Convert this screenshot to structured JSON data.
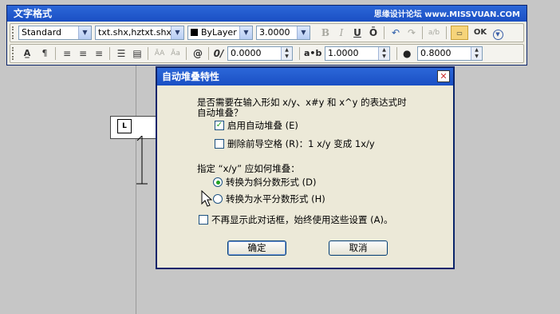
{
  "toolbar": {
    "title": "文字格式",
    "watermark": "思缘设计论坛 www.MISSVUAN.COM",
    "style_value": "Standard",
    "font_value": "txt.shx,hztxt.shx",
    "color_value": "ByLayer",
    "height_value": "3.0000",
    "bold_label": "B",
    "italic_label": "I",
    "underline_label": "U",
    "overline_label": "Ō",
    "ok_label": "OK",
    "oblique_value": "0.0000",
    "tracking_label": "a•b",
    "tracking_value": "1.0000",
    "width_label": "●",
    "width_value": "0.8000"
  },
  "canvas": {
    "mtext_marker": "L"
  },
  "dialog": {
    "title": "自动堆叠特性",
    "question_line1": "是否需要在输入形如 x/y、x#y 和 x^y 的表达式时",
    "question_line2": "自动堆叠？",
    "enable_label": "启用自动堆叠 (E)",
    "enable_checked": true,
    "remove_space_label": "删除前导空格 (R)：1 x/y 变成 1x/y",
    "remove_space_checked": false,
    "stack_prompt": "指定 “x/y” 应如何堆叠：",
    "option_diagonal": "转换为斜分数形式 (D)",
    "option_horizontal": "转换为水平分数形式 (H)",
    "selected_option": "diagonal",
    "dont_show_label": "不再显示此对话框，始终使用这些设置 (A)。",
    "dont_show_checked": false,
    "ok_label": "确定",
    "cancel_label": "取消"
  }
}
